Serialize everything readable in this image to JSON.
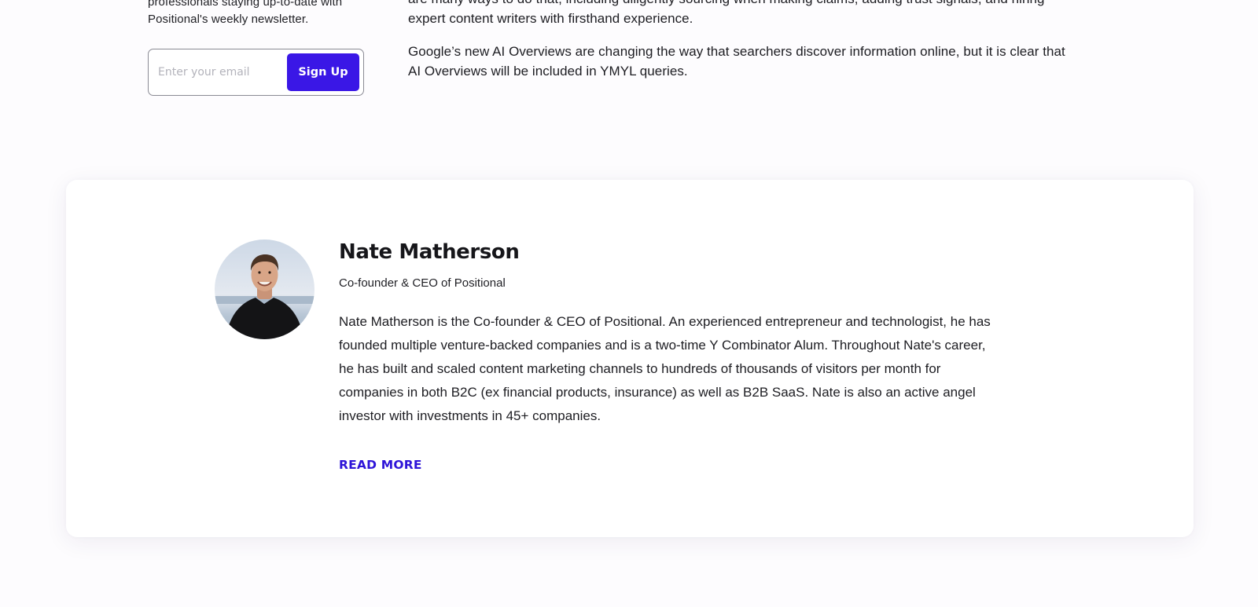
{
  "newsletter": {
    "text_lines": [
      "professionals staying up-to-date with",
      "Positional's weekly newsletter."
    ],
    "email_placeholder": "Enter your email",
    "signup_label": "Sign Up",
    "accent_color": "#3a17e6"
  },
  "article": {
    "paragraph_1_lines": [
      "are many ways to do that, including diligently sourcing when making claims, adding trust signals, and hiring",
      "expert content writers with firsthand experience."
    ],
    "paragraph_2_lines": [
      "Google’s new AI Overviews are changing the way that searchers discover information online, but it is clear that",
      "AI Overviews will be included in YMYL queries."
    ]
  },
  "author": {
    "name": "Nate Matherson",
    "role": "Co-founder & CEO of Positional",
    "bio_lines": [
      "Nate Matherson is the Co-founder & CEO of Positional. An experienced entrepreneur and technologist, he has",
      "founded multiple venture-backed companies and is a two-time Y Combinator Alum. Throughout Nate's career,",
      "he has built and scaled content marketing channels to hundreds of thousands of visitors per month for",
      "companies in both B2C (ex financial products, insurance) as well as B2B SaaS. Nate is also an active angel",
      "investor with investments in 45+ companies."
    ],
    "read_more_label": "READ MORE",
    "link_color": "#2e14d8"
  }
}
